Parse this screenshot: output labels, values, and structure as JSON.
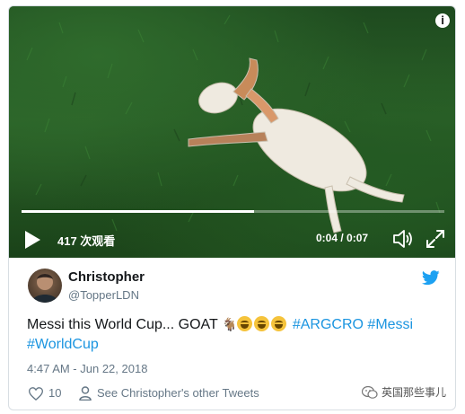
{
  "video": {
    "views_label": "417 次观看",
    "current_time": "0:04",
    "duration": "0:07",
    "time_separator": " / ",
    "progress": 0.55
  },
  "tweet": {
    "author_name": "Christopher",
    "author_handle": "@TopperLDN",
    "text_prefix": "Messi this World Cup... GOAT ",
    "hashtags": [
      "#ARGCRO",
      "#Messi",
      "#WorldCup"
    ],
    "timestamp": "4:47 AM - Jun 22, 2018",
    "likes": "10",
    "other_tweets_label": "See Christopher's other Tweets"
  },
  "watermark": {
    "label": "英国那些事儿"
  },
  "colors": {
    "twitter_blue": "#1da1f2",
    "hashtag": "#1b95e0",
    "meta_gray": "#657786"
  },
  "icons": [
    "info-icon",
    "play-icon",
    "volume-icon",
    "fullscreen-icon",
    "twitter-bird-icon",
    "heart-icon",
    "person-icon",
    "wechat-icon"
  ]
}
